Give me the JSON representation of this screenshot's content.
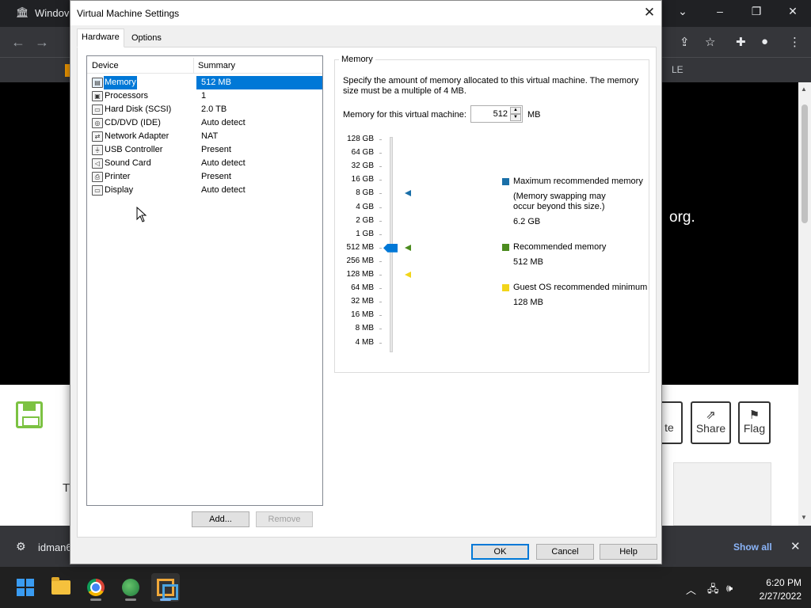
{
  "browser": {
    "title": "Windov",
    "bookmark_text": "LE",
    "video_text": "org.",
    "partial_btn_label": "te",
    "share_label": "Share",
    "flag_label": "Flag",
    "page_text": "T",
    "download_name": "idman6",
    "show_all": "Show all"
  },
  "taskbar": {
    "time": "6:20 PM",
    "date": "2/27/2022"
  },
  "dialog": {
    "title": "Virtual Machine Settings",
    "close": "✕",
    "tabs": [
      {
        "label": "Hardware"
      },
      {
        "label": "Options"
      }
    ],
    "device_list": {
      "col_device": "Device",
      "col_summary": "Summary",
      "selected": "Memory",
      "rows": [
        {
          "name": "Memory",
          "summary": "512 MB",
          "icon": "memory-icon"
        },
        {
          "name": "Processors",
          "summary": "1",
          "icon": "processor-icon"
        },
        {
          "name": "Hard Disk (SCSI)",
          "summary": "2.0 TB",
          "icon": "hard-disk-icon"
        },
        {
          "name": "CD/DVD (IDE)",
          "summary": "Auto detect",
          "icon": "cd-dvd-icon"
        },
        {
          "name": "Network Adapter",
          "summary": "NAT",
          "icon": "network-adapter-icon"
        },
        {
          "name": "USB Controller",
          "summary": "Present",
          "icon": "usb-icon"
        },
        {
          "name": "Sound Card",
          "summary": "Auto detect",
          "icon": "speaker-icon"
        },
        {
          "name": "Printer",
          "summary": "Present",
          "icon": "printer-icon"
        },
        {
          "name": "Display",
          "summary": "Auto detect",
          "icon": "monitor-icon"
        }
      ]
    },
    "buttons": {
      "add": "Add...",
      "remove": "Remove",
      "ok": "OK",
      "cancel": "Cancel",
      "help": "Help"
    },
    "memory": {
      "group_label": "Memory",
      "description": "Specify the amount of memory allocated to this virtual machine. The memory size must be a multiple of 4 MB.",
      "field_label": "Memory for this virtual machine:",
      "value": "512",
      "unit": "MB",
      "scale": [
        "128 GB",
        "64 GB",
        "32 GB",
        "16 GB",
        "8 GB",
        "4 GB",
        "2 GB",
        "1 GB",
        "512 MB",
        "256 MB",
        "128 MB",
        "64 MB",
        "32 MB",
        "16 MB",
        "8 MB",
        "4 MB"
      ],
      "slider_value": "512 MB",
      "max_recommended": {
        "label": "Maximum recommended memory",
        "note_line1": "(Memory swapping may",
        "note_line2": "occur beyond this size.)",
        "value": "6.2 GB",
        "color": "#1a6fa8",
        "marker_at": "8 GB"
      },
      "recommended": {
        "label": "Recommended memory",
        "value": "512 MB",
        "color": "#4c8c1f",
        "marker_at": "512 MB"
      },
      "guest_min": {
        "label": "Guest OS recommended minimum",
        "value": "128 MB",
        "color": "#f2d51a",
        "marker_at": "128 MB"
      }
    }
  }
}
